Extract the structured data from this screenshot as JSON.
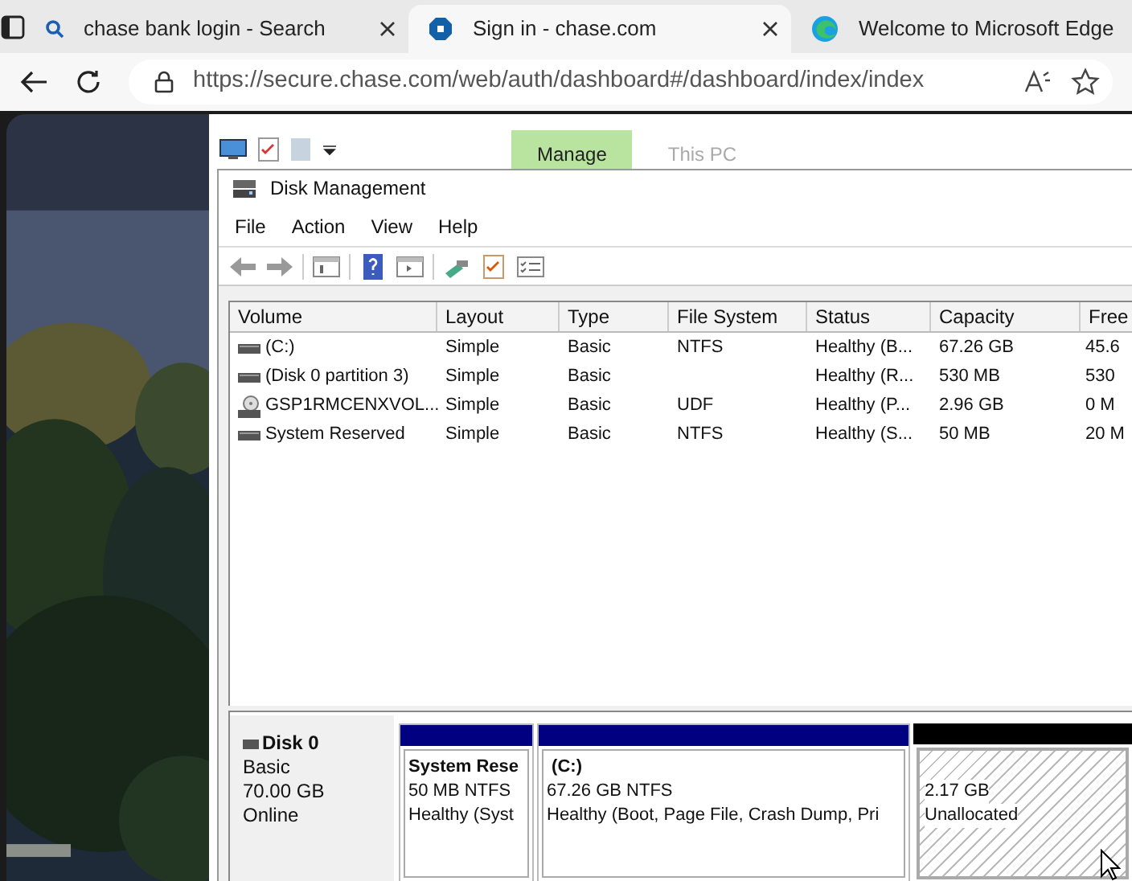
{
  "browser": {
    "tabs": [
      {
        "title": "chase bank login - Search",
        "selected": false
      },
      {
        "title": "Sign in - chase.com",
        "selected": true
      },
      {
        "title": "Welcome to Microsoft Edge",
        "selected": false
      }
    ],
    "address": "https://secure.chase.com/web/auth/dashboard#/dashboard/index/index"
  },
  "explorer": {
    "ribbon_tabs": [
      {
        "label": "Manage",
        "selected": true
      },
      {
        "label": "This PC",
        "selected": false
      }
    ]
  },
  "disk_management": {
    "title": "Disk Management",
    "menu": [
      "File",
      "Action",
      "View",
      "Help"
    ],
    "table": {
      "columns": [
        "Volume",
        "Layout",
        "Type",
        "File System",
        "Status",
        "Capacity",
        "Free"
      ],
      "rows": [
        {
          "kind": "disk",
          "cells": [
            " (C:)",
            "Simple",
            "Basic",
            "NTFS",
            "Healthy (B...",
            "67.26 GB",
            "45.6"
          ]
        },
        {
          "kind": "disk",
          "cells": [
            "(Disk 0 partition 3)",
            "Simple",
            "Basic",
            "",
            "Healthy (R...",
            "530 MB",
            "530"
          ]
        },
        {
          "kind": "cd",
          "cells": [
            "GSP1RMCENXVOL...",
            "Simple",
            "Basic",
            "UDF",
            "Healthy (P...",
            "2.96 GB",
            "0 M"
          ]
        },
        {
          "kind": "disk",
          "cells": [
            "System Reserved",
            "Simple",
            "Basic",
            "NTFS",
            "Healthy (S...",
            "50 MB",
            "20 M"
          ]
        }
      ]
    },
    "disk": {
      "name": "Disk 0",
      "type": "Basic",
      "size": "70.00 GB",
      "status": "Online",
      "partitions": [
        {
          "kind": "primary",
          "name": "System Rese",
          "size": "50 MB NTFS",
          "status": "Healthy (Syst"
        },
        {
          "kind": "primary",
          "name": " (C:)",
          "size": "67.26 GB NTFS",
          "status": "Healthy (Boot, Page File, Crash Dump, Pri"
        },
        {
          "kind": "unallocated",
          "size": "2.17 GB",
          "status": "Unallocated"
        }
      ]
    }
  }
}
